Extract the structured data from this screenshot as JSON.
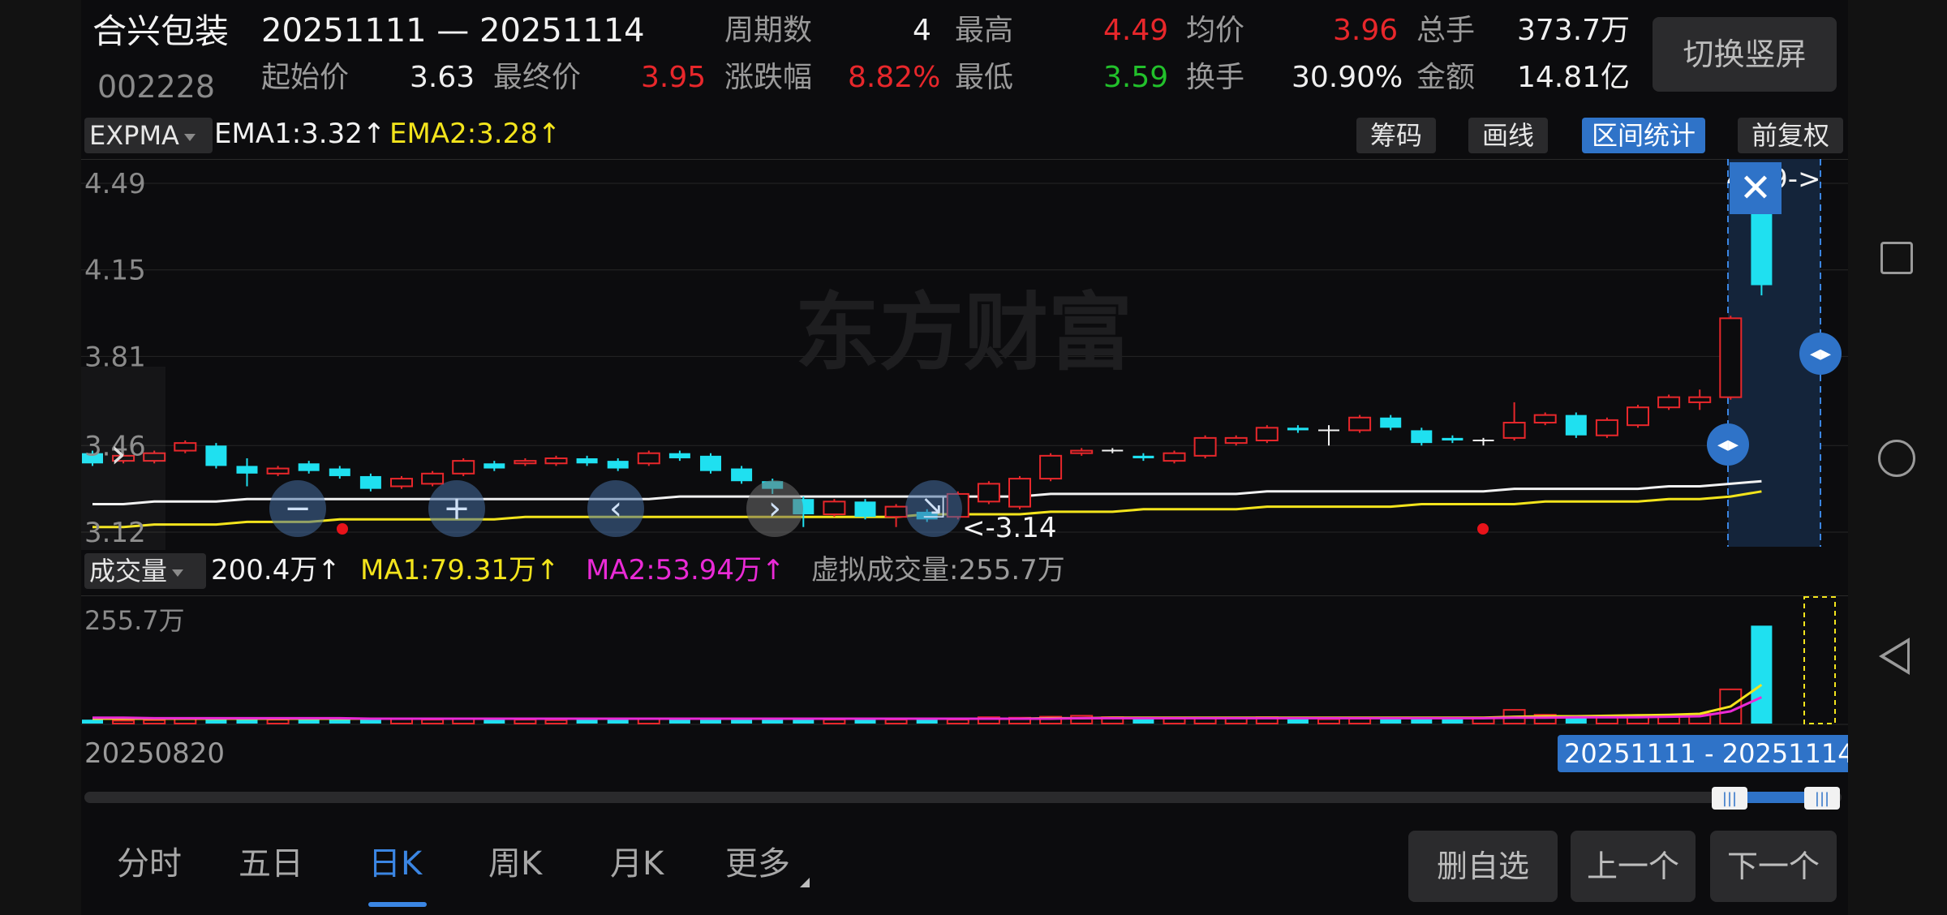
{
  "header": {
    "stock_name": "合兴包装",
    "stock_code": "002228",
    "range": "20251111 — 20251114",
    "period_count_label": "周期数",
    "period_count": "4",
    "high_label": "最高",
    "high": "4.49",
    "avg_label": "均价",
    "avg": "3.96",
    "total_hands_label": "总手",
    "total_hands": "373.7万",
    "start_price_label": "起始价",
    "start_price": "3.63",
    "end_price_label": "最终价",
    "end_price": "3.95",
    "change_label": "涨跌幅",
    "change": "8.82%",
    "low_label": "最低",
    "low": "3.59",
    "turnover_label": "换手",
    "turnover": "30.90%",
    "amount_label": "金额",
    "amount": "14.81亿",
    "switch_button": "切换竖屏"
  },
  "main_indicator": {
    "name": "EXPMA",
    "ema1": "EMA1:3.32↑",
    "ema2": "EMA2:3.28↑",
    "tools": [
      "筹码",
      "画线",
      "区间统计",
      "前复权"
    ],
    "active_tool": "区间统计",
    "y_ticks": [
      "4.49",
      "4.15",
      "3.81",
      "3.46",
      "3.12"
    ],
    "max_annotation": "4.49->",
    "min_annotation": "<-3.14",
    "watermark": "东方财富"
  },
  "volume_indicator": {
    "name": "成交量",
    "value": "200.4万↑",
    "ma1": "MA1:79.31万↑",
    "ma2": "MA2:53.94万↑",
    "virtual": "虚拟成交量:255.7万",
    "max_tick": "255.7万"
  },
  "timeline": {
    "start_date": "20250820",
    "range_label": "20251111 - 20251114"
  },
  "bottom_tabs": [
    "分时",
    "五日",
    "日K",
    "周K",
    "月K",
    "更多"
  ],
  "active_tab": "日K",
  "bottom_buttons": {
    "remove_watch": "删自选",
    "prev": "上一个",
    "next": "下一个"
  },
  "colors": {
    "up": "#e8272b",
    "down": "#1fe0f0",
    "ema1": "#f2f2f2",
    "ema2": "#f3e41c",
    "ma2": "#ea2ad6",
    "accent": "#2f73c8"
  },
  "chart_data": {
    "type": "candlestick",
    "price_range": [
      3.12,
      4.49
    ],
    "candles": [
      {
        "o": 3.43,
        "c": 3.39,
        "h": 3.44,
        "l": 3.38
      },
      {
        "o": 3.4,
        "c": 3.42,
        "h": 3.43,
        "l": 3.39
      },
      {
        "o": 3.4,
        "c": 3.43,
        "h": 3.44,
        "l": 3.39
      },
      {
        "o": 3.44,
        "c": 3.47,
        "h": 3.48,
        "l": 3.43
      },
      {
        "o": 3.46,
        "c": 3.38,
        "h": 3.47,
        "l": 3.37
      },
      {
        "o": 3.38,
        "c": 3.35,
        "h": 3.41,
        "l": 3.3
      },
      {
        "o": 3.35,
        "c": 3.37,
        "h": 3.38,
        "l": 3.34
      },
      {
        "o": 3.39,
        "c": 3.36,
        "h": 3.4,
        "l": 3.35
      },
      {
        "o": 3.37,
        "c": 3.34,
        "h": 3.38,
        "l": 3.33
      },
      {
        "o": 3.34,
        "c": 3.29,
        "h": 3.35,
        "l": 3.28
      },
      {
        "o": 3.3,
        "c": 3.33,
        "h": 3.34,
        "l": 3.29
      },
      {
        "o": 3.31,
        "c": 3.35,
        "h": 3.36,
        "l": 3.3
      },
      {
        "o": 3.35,
        "c": 3.4,
        "h": 3.41,
        "l": 3.34
      },
      {
        "o": 3.39,
        "c": 3.37,
        "h": 3.4,
        "l": 3.36
      },
      {
        "o": 3.39,
        "c": 3.4,
        "h": 3.41,
        "l": 3.38
      },
      {
        "o": 3.39,
        "c": 3.41,
        "h": 3.42,
        "l": 3.38
      },
      {
        "o": 3.41,
        "c": 3.39,
        "h": 3.42,
        "l": 3.38
      },
      {
        "o": 3.4,
        "c": 3.37,
        "h": 3.41,
        "l": 3.36
      },
      {
        "o": 3.39,
        "c": 3.43,
        "h": 3.44,
        "l": 3.38
      },
      {
        "o": 3.43,
        "c": 3.41,
        "h": 3.44,
        "l": 3.4
      },
      {
        "o": 3.42,
        "c": 3.36,
        "h": 3.43,
        "l": 3.35
      },
      {
        "o": 3.37,
        "c": 3.32,
        "h": 3.38,
        "l": 3.31
      },
      {
        "o": 3.32,
        "c": 3.29,
        "h": 3.33,
        "l": 3.27
      },
      {
        "o": 3.25,
        "c": 3.19,
        "h": 3.26,
        "l": 3.14
      },
      {
        "o": 3.19,
        "c": 3.24,
        "h": 3.25,
        "l": 3.18
      },
      {
        "o": 3.24,
        "c": 3.18,
        "h": 3.25,
        "l": 3.17
      },
      {
        "o": 3.18,
        "c": 3.22,
        "h": 3.23,
        "l": 3.14
      },
      {
        "o": 3.2,
        "c": 3.17,
        "h": 3.21,
        "l": 3.16
      },
      {
        "o": 3.18,
        "c": 3.27,
        "h": 3.28,
        "l": 3.17
      },
      {
        "o": 3.24,
        "c": 3.31,
        "h": 3.32,
        "l": 3.23
      },
      {
        "o": 3.22,
        "c": 3.33,
        "h": 3.34,
        "l": 3.21
      },
      {
        "o": 3.33,
        "c": 3.42,
        "h": 3.43,
        "l": 3.32
      },
      {
        "o": 3.43,
        "c": 3.44,
        "h": 3.45,
        "l": 3.42
      },
      {
        "o": 3.44,
        "c": 3.44,
        "h": 3.45,
        "l": 3.43
      },
      {
        "o": 3.42,
        "c": 3.41,
        "h": 3.43,
        "l": 3.4
      },
      {
        "o": 3.4,
        "c": 3.43,
        "h": 3.44,
        "l": 3.39
      },
      {
        "o": 3.42,
        "c": 3.49,
        "h": 3.5,
        "l": 3.41
      },
      {
        "o": 3.47,
        "c": 3.49,
        "h": 3.5,
        "l": 3.46
      },
      {
        "o": 3.48,
        "c": 3.53,
        "h": 3.54,
        "l": 3.47
      },
      {
        "o": 3.53,
        "c": 3.52,
        "h": 3.54,
        "l": 3.51
      },
      {
        "o": 3.52,
        "c": 3.52,
        "h": 3.54,
        "l": 3.46
      },
      {
        "o": 3.52,
        "c": 3.57,
        "h": 3.58,
        "l": 3.51
      },
      {
        "o": 3.57,
        "c": 3.53,
        "h": 3.58,
        "l": 3.52
      },
      {
        "o": 3.52,
        "c": 3.47,
        "h": 3.53,
        "l": 3.46
      },
      {
        "o": 3.49,
        "c": 3.48,
        "h": 3.5,
        "l": 3.47
      },
      {
        "o": 3.48,
        "c": 3.48,
        "h": 3.49,
        "l": 3.46
      },
      {
        "o": 3.49,
        "c": 3.55,
        "h": 3.63,
        "l": 3.48
      },
      {
        "o": 3.55,
        "c": 3.58,
        "h": 3.59,
        "l": 3.54
      },
      {
        "o": 3.58,
        "c": 3.5,
        "h": 3.59,
        "l": 3.49
      },
      {
        "o": 3.5,
        "c": 3.56,
        "h": 3.57,
        "l": 3.49
      },
      {
        "o": 3.54,
        "c": 3.61,
        "h": 3.62,
        "l": 3.53
      },
      {
        "o": 3.61,
        "c": 3.65,
        "h": 3.66,
        "l": 3.6
      },
      {
        "o": 3.63,
        "c": 3.65,
        "h": 3.68,
        "l": 3.6
      },
      {
        "o": 3.65,
        "c": 3.96,
        "h": 3.97,
        "l": 3.64
      },
      {
        "o": 4.39,
        "c": 4.09,
        "h": 4.49,
        "l": 4.05
      }
    ],
    "ema1": [
      3.23,
      3.23,
      3.24,
      3.24,
      3.24,
      3.25,
      3.25,
      3.25,
      3.25,
      3.25,
      3.25,
      3.25,
      3.25,
      3.25,
      3.25,
      3.25,
      3.25,
      3.25,
      3.25,
      3.26,
      3.26,
      3.26,
      3.26,
      3.26,
      3.26,
      3.26,
      3.26,
      3.26,
      3.26,
      3.26,
      3.26,
      3.27,
      3.27,
      3.27,
      3.27,
      3.27,
      3.27,
      3.27,
      3.28,
      3.28,
      3.28,
      3.28,
      3.28,
      3.28,
      3.28,
      3.28,
      3.29,
      3.29,
      3.29,
      3.29,
      3.29,
      3.3,
      3.3,
      3.31,
      3.32
    ],
    "ema2": [
      3.14,
      3.14,
      3.15,
      3.15,
      3.15,
      3.16,
      3.16,
      3.16,
      3.17,
      3.17,
      3.17,
      3.17,
      3.17,
      3.17,
      3.18,
      3.18,
      3.18,
      3.18,
      3.18,
      3.18,
      3.18,
      3.18,
      3.18,
      3.18,
      3.18,
      3.18,
      3.18,
      3.19,
      3.19,
      3.19,
      3.19,
      3.2,
      3.2,
      3.2,
      3.21,
      3.21,
      3.21,
      3.21,
      3.22,
      3.22,
      3.22,
      3.22,
      3.22,
      3.23,
      3.23,
      3.23,
      3.23,
      3.24,
      3.24,
      3.24,
      3.24,
      3.25,
      3.25,
      3.26,
      3.28
    ],
    "volume_range": [
      0,
      255.7
    ],
    "volume": [
      8,
      6,
      7,
      9,
      12,
      10,
      8,
      9,
      11,
      12,
      9,
      8,
      10,
      9,
      8,
      7,
      8,
      9,
      10,
      8,
      11,
      10,
      9,
      10,
      8,
      9,
      8,
      9,
      8,
      13,
      12,
      14,
      16,
      13,
      11,
      10,
      12,
      11,
      13,
      10,
      9,
      10,
      11,
      12,
      10,
      11,
      28,
      18,
      15,
      14,
      16,
      17,
      20,
      70,
      200.4
    ],
    "vol_ma1": [
      10,
      10,
      10,
      10,
      10,
      10,
      10,
      10,
      10,
      10,
      10,
      10,
      10,
      10,
      10,
      10,
      10,
      10,
      10,
      10,
      10,
      10,
      10,
      10,
      10,
      10,
      10,
      10,
      10,
      10,
      10,
      11,
      11,
      12,
      12,
      12,
      12,
      12,
      12,
      12,
      12,
      12,
      12,
      12,
      12,
      12,
      14,
      15,
      15,
      16,
      17,
      18,
      20,
      35,
      79.31
    ],
    "vol_ma2": [
      12,
      12,
      11,
      11,
      11,
      11,
      11,
      11,
      11,
      10,
      10,
      10,
      10,
      10,
      10,
      10,
      10,
      10,
      10,
      10,
      10,
      10,
      10,
      10,
      10,
      10,
      10,
      10,
      10,
      10,
      10,
      10,
      11,
      11,
      11,
      11,
      11,
      11,
      11,
      11,
      11,
      11,
      11,
      11,
      11,
      11,
      12,
      12,
      13,
      13,
      13,
      14,
      15,
      25,
      53.94
    ]
  }
}
